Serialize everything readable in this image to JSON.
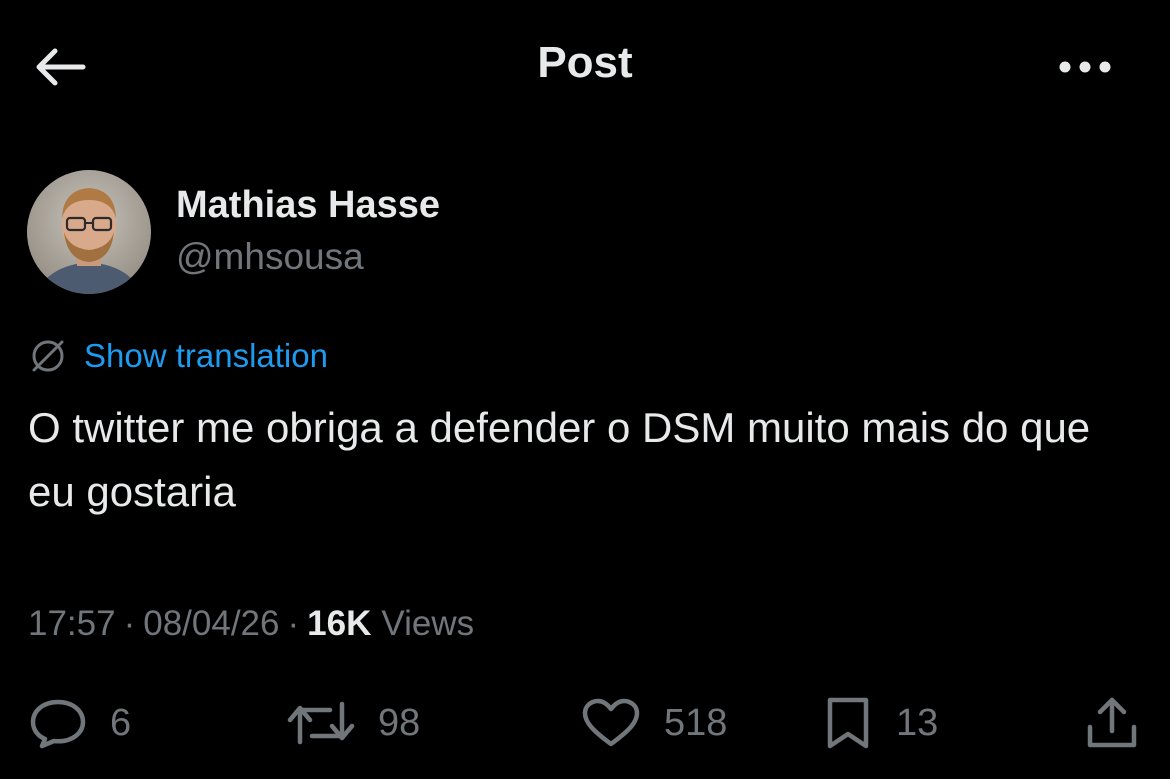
{
  "header": {
    "title": "Post",
    "back_icon": "arrow-left-icon",
    "more_icon": "ellipsis-icon"
  },
  "author": {
    "name": "Mathias Hasse",
    "handle": "@mhsousa"
  },
  "translation": {
    "label": "Show translation",
    "icon": "translate-globe-icon"
  },
  "post": {
    "text": "O twitter me obriga a defender o DSM muito mais do que eu gostaria"
  },
  "meta": {
    "time": "17:57",
    "date": "08/04/26",
    "separator": "·",
    "views_count": "16K",
    "views_label": "Views"
  },
  "actions": {
    "replies": "6",
    "reposts": "98",
    "likes": "518",
    "bookmarks": "13"
  },
  "colors": {
    "background": "#000000",
    "text_primary": "#e7e9ea",
    "text_secondary": "#71767b",
    "accent": "#1d9bf0"
  }
}
